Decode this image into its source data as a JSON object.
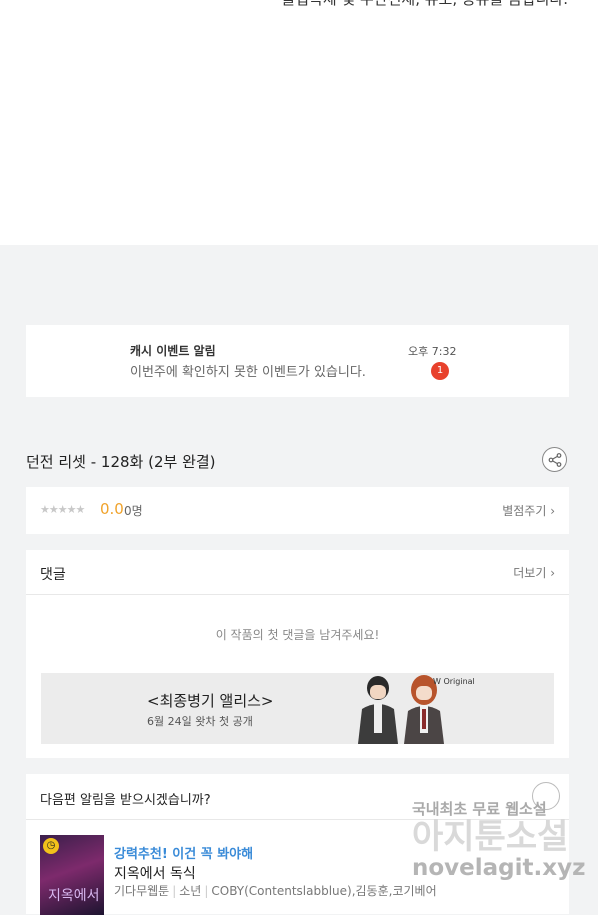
{
  "top": {
    "clipped_text": "불법복제 및 무단전제, 유포, 공유를 금합니다."
  },
  "notification": {
    "title": "캐시 이벤트 알림",
    "message": "이번주에 확인하지 못한 이벤트가 있습니다.",
    "time": "오후 7:32",
    "badge_count": "1"
  },
  "episode": {
    "title": "던전 리셋 - 128화 (2부 완결)",
    "share_icon": "share-icon"
  },
  "rating": {
    "stars": "★★★★★",
    "score": "0.0",
    "count": "0명",
    "rate_link": "별점주기 ›"
  },
  "comments": {
    "heading": "댓글",
    "more": "더보기 ›",
    "empty_message": "이 작품의 첫 댓글을 남겨주세요!"
  },
  "banner": {
    "title": "<최종병기 앨리스>",
    "subtitle": "6월 24일 왓차 첫 공개",
    "logo": "W Original"
  },
  "next_episode": {
    "question": "다음편 알림을 받으시겠습니까?",
    "recommend": "강력추천! 이건 꼭 봐야해",
    "work_title": "지옥에서 독식",
    "thumb_text": "지옥에서",
    "meta": [
      "기다무웹툰",
      "소년",
      "COBY(Contentslabblue),김동훈,코기베어"
    ]
  },
  "watermark": {
    "line1": "국내최초 무료 웹소설",
    "line2": "아지툰소설",
    "line3": "novelagit.xyz"
  },
  "colors": {
    "accent": "#f0a32c",
    "badge": "#e8412c",
    "link_blue": "#3a8bd8"
  }
}
